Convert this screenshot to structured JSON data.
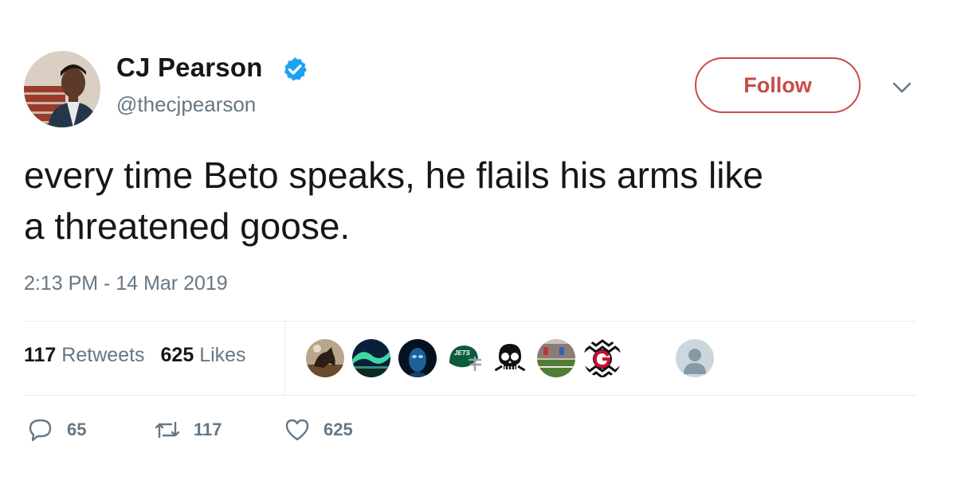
{
  "author": {
    "name": "CJ Pearson",
    "handle": "@thecjpearson",
    "verified": true,
    "avatar_icon": "profile-photo"
  },
  "follow_label": "Follow",
  "menu_icon": "chevron-down-icon",
  "tweet": {
    "line1": "every time Beto speaks, he flails his arms like",
    "line2": "a threatened goose."
  },
  "timestamp": "2:13 PM - 14 Mar 2019",
  "stats": {
    "retweets_count": "117",
    "retweets_label": "Retweets",
    "likes_count": "625",
    "likes_label": "Likes"
  },
  "likers": [
    {
      "icon": "horse-painting-avatar"
    },
    {
      "icon": "aurora-landscape-avatar"
    },
    {
      "icon": "blue-face-avatar"
    },
    {
      "icon": "jets-helmet-avatar"
    },
    {
      "icon": "skull-avatar"
    },
    {
      "icon": "stadium-field-avatar"
    },
    {
      "icon": "georgia-g-avatar"
    },
    {
      "icon": "default-user-avatar"
    }
  ],
  "actions": {
    "replies": "65",
    "retweets": "117",
    "likes": "625"
  },
  "colors": {
    "follow_accent": "#c94a4a",
    "verified_blue": "#1da1f2",
    "muted_text": "#657786",
    "primary_text": "#14171a"
  }
}
